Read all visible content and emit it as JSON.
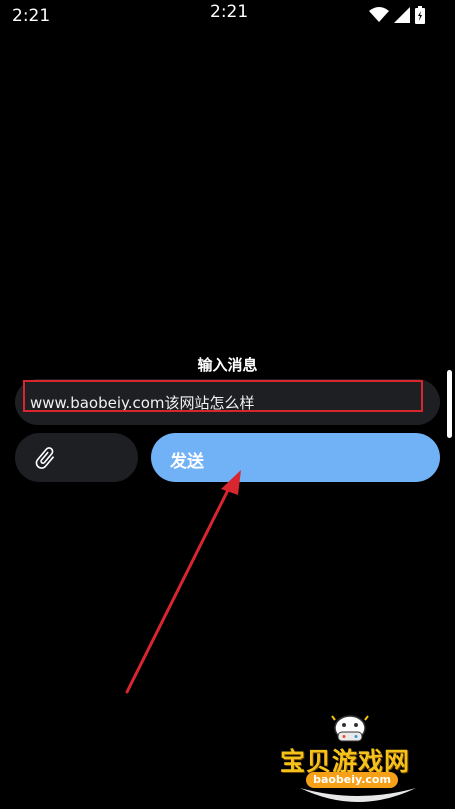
{
  "status_bar": {
    "time_left": "2:21",
    "time_center": "2:21",
    "icons": [
      "wifi-icon",
      "signal-icon",
      "battery-charging-icon"
    ]
  },
  "composer": {
    "title": "输入消息",
    "input_value": "www.baobeiy.com该网站怎么样",
    "send_label": "发送",
    "attach_icon": "paperclip-icon"
  },
  "watermark": {
    "title": "宝贝游戏网",
    "url": "baobeiy.com"
  },
  "colors": {
    "background": "#000000",
    "field_background": "#1e1f23",
    "send_button": "#71b1f5",
    "annotation_red": "#d7262d",
    "watermark_gold": "#f4c21b"
  }
}
